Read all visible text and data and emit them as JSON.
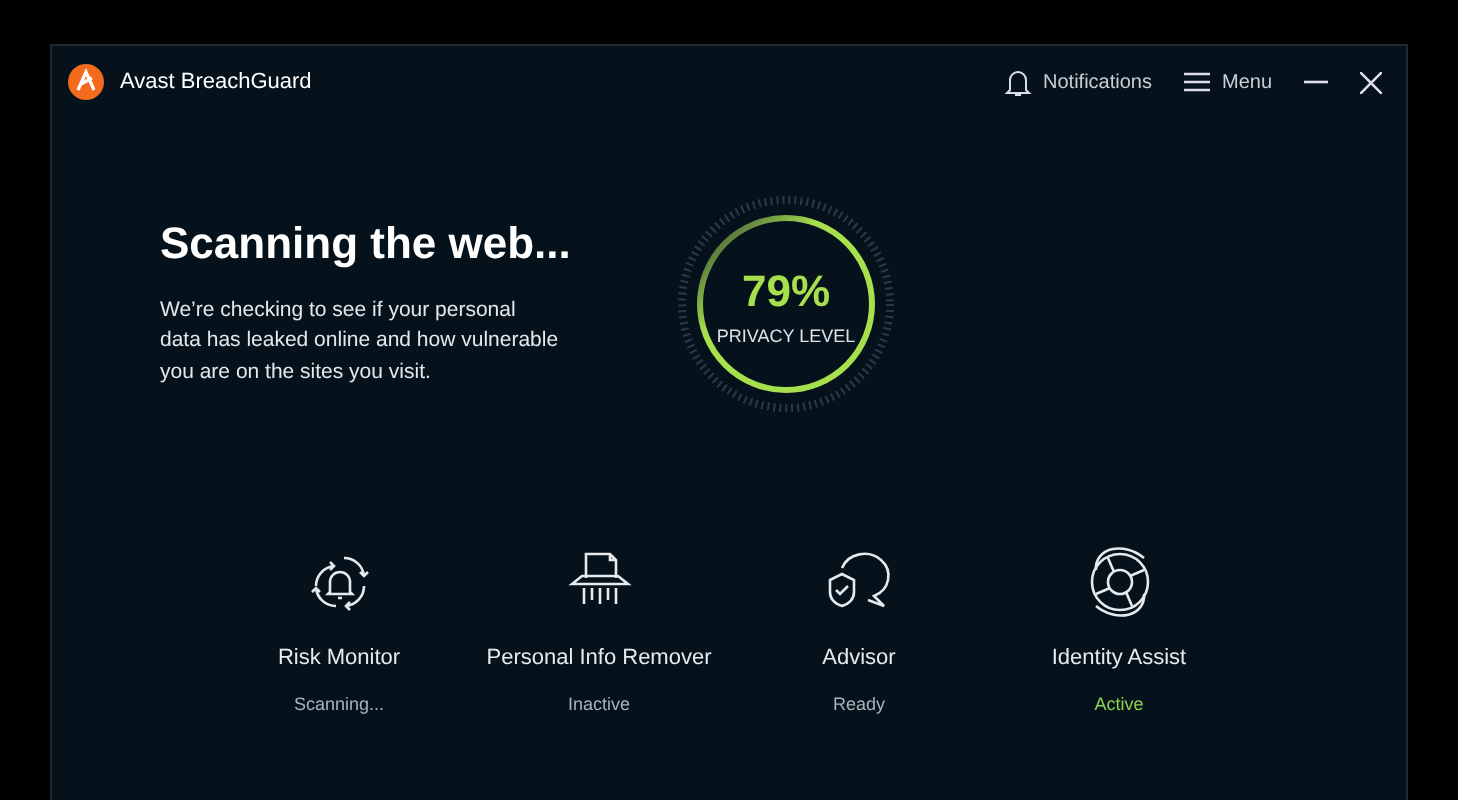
{
  "app": {
    "title": "Avast BreachGuard"
  },
  "header": {
    "notifications": "Notifications",
    "menu": "Menu"
  },
  "scan": {
    "heading": "Scanning the web...",
    "description": "We’re checking to see if your personal data has leaked online and how vulnerable you are on the sites you visit.",
    "percent": "79%",
    "gauge_label": "PRIVACY LEVEL"
  },
  "features": [
    {
      "kind": "monitor",
      "name": "Risk Monitor",
      "status": "Scanning...",
      "active": false
    },
    {
      "kind": "shredder",
      "name": "Personal Info Remover",
      "status": "Inactive",
      "active": false
    },
    {
      "kind": "advisor",
      "name": "Advisor",
      "status": "Ready",
      "active": false
    },
    {
      "kind": "lifebuoy",
      "name": "Identity Assist",
      "status": "Active",
      "active": true
    }
  ]
}
